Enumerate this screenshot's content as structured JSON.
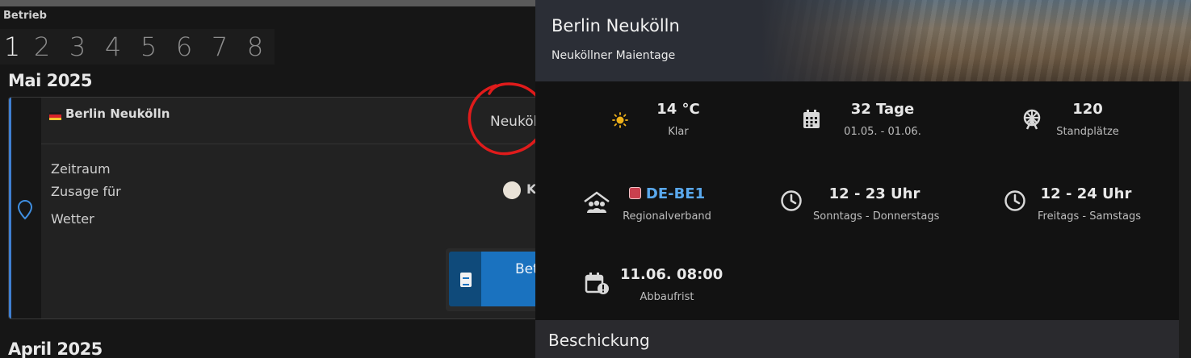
{
  "left": {
    "section_label": "Betrieb",
    "pages": [
      "1",
      "2",
      "3",
      "4",
      "5",
      "6",
      "7",
      "8"
    ],
    "active_page": "1",
    "month_current": "Mai 2025",
    "month_next": "April 2025",
    "card": {
      "title": "Berlin Neukölln",
      "subtitle": "Neuköl",
      "rows": [
        "Zeitraum",
        "Zusage für",
        "Wetter"
      ],
      "avatar_text": "K",
      "action_label": "Bet"
    }
  },
  "right": {
    "title": "Berlin Neukölln",
    "subtitle": "Neuköllner Maientage",
    "stats": {
      "weather": {
        "value": "14 °C",
        "label": "Klar",
        "icon": "sun-icon"
      },
      "duration": {
        "value": "32 Tage",
        "label": "01.05. - 01.06.",
        "icon": "calendar-icon"
      },
      "spots": {
        "value": "120",
        "label": "Standplätze",
        "icon": "ferris-wheel-icon"
      },
      "region": {
        "value": "DE-BE1",
        "label": "Regionalverband",
        "icon": "association-icon",
        "badge_color": "#c9404e"
      },
      "hours_weekday": {
        "value": "12 - 23 Uhr",
        "label": "Sonntags - Donnerstags",
        "icon": "clock-icon"
      },
      "hours_weekend": {
        "value": "12 - 24 Uhr",
        "label": "Freitags - Samstags",
        "icon": "clock-icon"
      },
      "teardown": {
        "value": "11.06. 08:00",
        "label": "Abbaufrist",
        "icon": "calendar-alert-icon"
      }
    },
    "section_title": "Beschickung"
  },
  "colors": {
    "accent": "#3f7fd1",
    "link": "#5aa9ee",
    "annotation": "#e01b1b"
  }
}
